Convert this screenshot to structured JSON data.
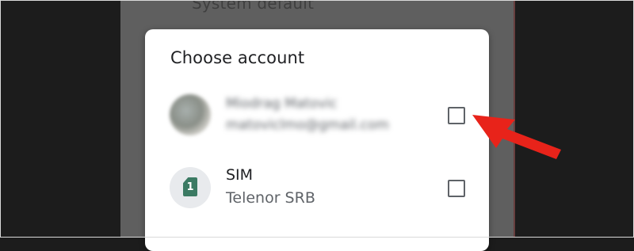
{
  "background": {
    "item_text": "System default"
  },
  "dialog": {
    "title": "Choose account",
    "accounts": [
      {
        "type": "google",
        "name": "Miodrag Matovic",
        "email": "matoviclmo@gmail.com",
        "checked": false,
        "obscured": true
      },
      {
        "type": "sim",
        "icon_text": "1",
        "title": "SIM",
        "subtitle": "Telenor SRB",
        "checked": false
      }
    ]
  },
  "annotation": {
    "arrow_color": "#e8231a"
  },
  "colors": {
    "sim_icon": "#3b7a63",
    "backdrop": "#1c1c1c"
  }
}
